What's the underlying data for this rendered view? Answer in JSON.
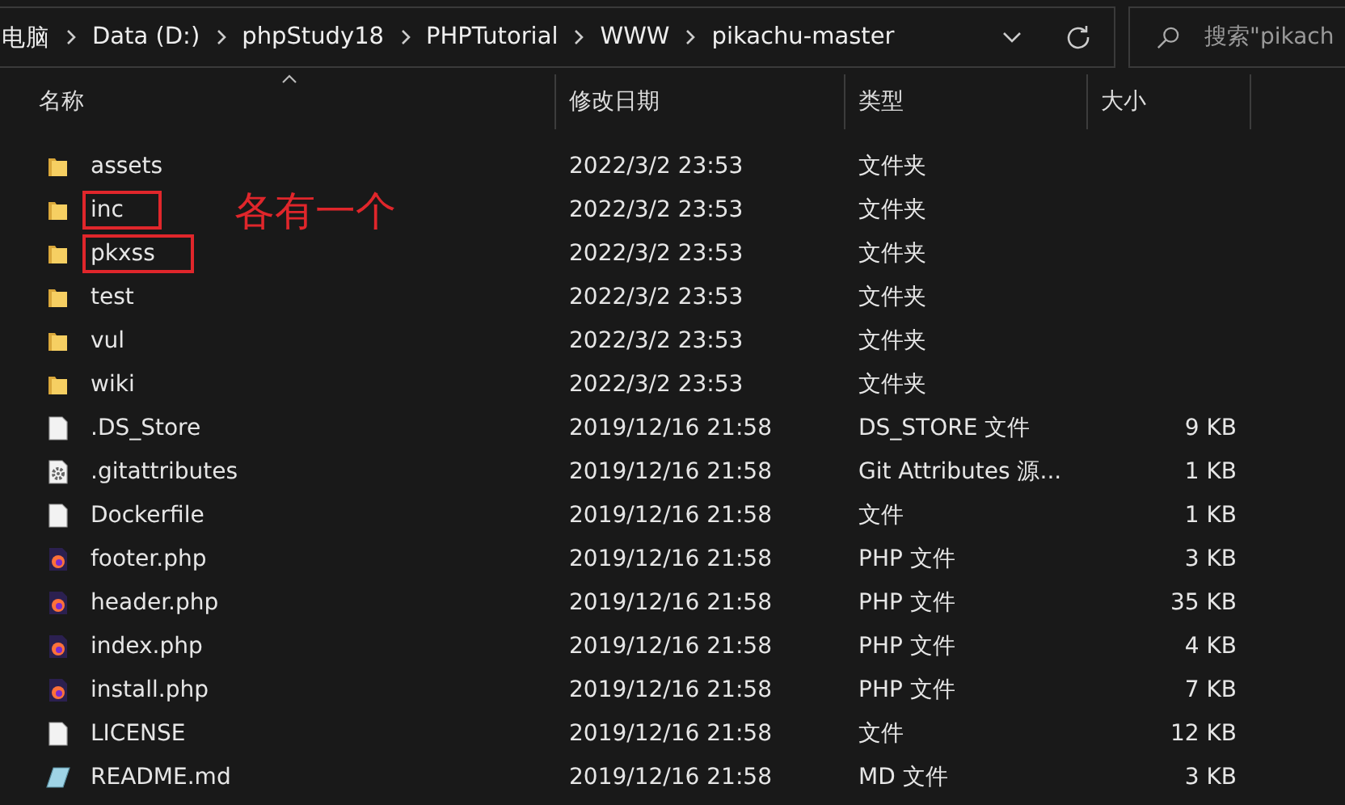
{
  "address_bar": {
    "breadcrumbs": [
      "电脑",
      "Data (D:)",
      "phpStudy18",
      "PHPTutorial",
      "WWW",
      "pikachu-master"
    ]
  },
  "search": {
    "placeholder": "搜索\"pikach"
  },
  "columns": [
    {
      "label": "名称",
      "sorted": true
    },
    {
      "label": "修改日期",
      "sorted": false
    },
    {
      "label": "类型",
      "sorted": false
    },
    {
      "label": "大小",
      "sorted": false
    }
  ],
  "files": [
    {
      "kind": "folder",
      "name": "assets",
      "date": "2022/3/2 23:53",
      "type": "文件夹",
      "highlighted": false
    },
    {
      "kind": "folder",
      "name": "inc",
      "date": "2022/3/2 23:53",
      "type": "文件夹",
      "highlighted": true
    },
    {
      "kind": "folder",
      "name": "pkxss",
      "date": "2022/3/2 23:53",
      "type": "文件夹",
      "highlighted": true
    },
    {
      "kind": "folder",
      "name": "test",
      "date": "2022/3/2 23:53",
      "type": "文件夹",
      "highlighted": false
    },
    {
      "kind": "folder",
      "name": "vul",
      "date": "2022/3/2 23:53",
      "type": "文件夹",
      "highlighted": false
    },
    {
      "kind": "folder",
      "name": "wiki",
      "date": "2022/3/2 23:53",
      "type": "文件夹",
      "highlighted": false
    },
    {
      "kind": "file",
      "name": ".DS_Store",
      "date": "2019/12/16 21:58",
      "type": "DS_STORE 文件",
      "size": "9 KB",
      "highlighted": false
    },
    {
      "kind": "config",
      "name": ".gitattributes",
      "date": "2019/12/16 21:58",
      "type": "Git Attributes 源...",
      "size": "1 KB",
      "highlighted": false
    },
    {
      "kind": "file",
      "name": "Dockerfile",
      "date": "2019/12/16 21:58",
      "type": "文件",
      "size": "1 KB",
      "highlighted": false
    },
    {
      "kind": "php",
      "name": "footer.php",
      "date": "2019/12/16 21:58",
      "type": "PHP 文件",
      "size": "3 KB",
      "highlighted": false
    },
    {
      "kind": "php",
      "name": "header.php",
      "date": "2019/12/16 21:58",
      "type": "PHP 文件",
      "size": "35 KB",
      "highlighted": false
    },
    {
      "kind": "php",
      "name": "index.php",
      "date": "2019/12/16 21:58",
      "type": "PHP 文件",
      "size": "4 KB",
      "highlighted": false
    },
    {
      "kind": "php",
      "name": "install.php",
      "date": "2019/12/16 21:58",
      "type": "PHP 文件",
      "size": "7 KB",
      "highlighted": false
    },
    {
      "kind": "file",
      "name": "LICENSE",
      "date": "2019/12/16 21:58",
      "type": "文件",
      "size": "12 KB",
      "highlighted": false
    },
    {
      "kind": "markdown",
      "name": "README.md",
      "date": "2019/12/16 21:58",
      "type": "MD 文件",
      "size": "3 KB",
      "highlighted": false
    }
  ],
  "annotation": {
    "text": "各有一个"
  }
}
